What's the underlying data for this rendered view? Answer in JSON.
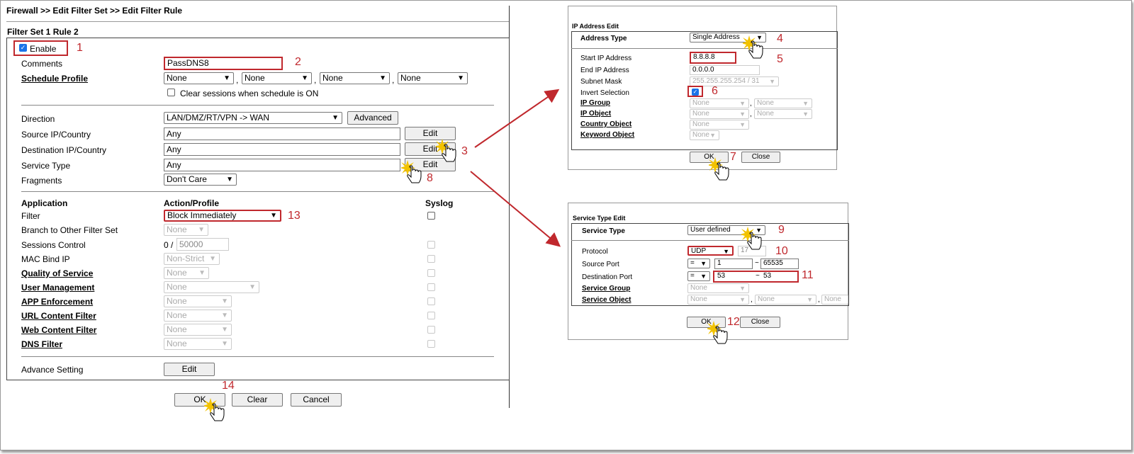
{
  "main": {
    "breadcrumb": "Firewall >> Edit Filter Set >> Edit Filter Rule",
    "section_title": "Filter Set 1 Rule 2",
    "enable_label": "Enable",
    "comments_label": "Comments",
    "comments_value": "PassDNS8",
    "schedule_label": "Schedule Profile",
    "schedule_values": [
      "None",
      "None",
      "None",
      "None"
    ],
    "clear_sessions_label": "Clear sessions when schedule is ON",
    "direction_label": "Direction",
    "direction_value": "LAN/DMZ/RT/VPN -> WAN",
    "advanced_button": "Advanced",
    "source_label": "Source IP/Country",
    "source_value": "Any",
    "destination_label": "Destination IP/Country",
    "destination_value": "Any",
    "service_label": "Service Type",
    "service_value": "Any",
    "edit_button": "Edit",
    "fragments_label": "Fragments",
    "fragments_value": "Don't Care",
    "col_application": "Application",
    "col_action": "Action/Profile",
    "col_syslog": "Syslog",
    "filter_label": "Filter",
    "filter_value": "Block Immediately",
    "branch_label": "Branch to Other Filter Set",
    "branch_value": "None",
    "sessions_label": "Sessions Control",
    "sessions_prefix": "0 /",
    "sessions_value": "50000",
    "mac_label": "MAC Bind IP",
    "mac_value": "Non-Strict",
    "qos_label": "Quality of Service",
    "qos_value": "None",
    "user_label": "User Management",
    "user_value": "None",
    "app_label": "APP Enforcement",
    "app_value": "None",
    "url_label": "URL Content Filter",
    "url_value": "None",
    "web_label": "Web Content Filter",
    "web_value": "None",
    "dns_label": "DNS Filter",
    "dns_value": "None",
    "advance_label": "Advance Setting",
    "ok_button": "OK",
    "clear_button": "Clear",
    "cancel_button": "Cancel"
  },
  "ip_dialog": {
    "title": "IP Address Edit",
    "address_type_label": "Address Type",
    "address_type_value": "Single Address",
    "start_ip_label": "Start IP Address",
    "start_ip_value": "8.8.8.8",
    "end_ip_label": "End IP Address",
    "end_ip_value": "0.0.0.0",
    "mask_label": "Subnet Mask",
    "mask_value": "255.255.255.254 / 31",
    "invert_label": "Invert Selection",
    "ip_group_label": "IP Group",
    "ip_object_label": "IP Object",
    "country_label": "Country Object",
    "keyword_label": "Keyword Object",
    "none": "None",
    "ok_button": "OK",
    "close_button": "Close"
  },
  "svc_dialog": {
    "title": "Service Type Edit",
    "service_type_label": "Service Type",
    "service_type_value": "User defined",
    "protocol_label": "Protocol",
    "protocol_value": "UDP",
    "protocol_number": "17",
    "source_port_label": "Source Port",
    "source_port_op": "=",
    "source_port_from": "1",
    "source_port_tilde": "~",
    "source_port_to": "65535",
    "dest_port_label": "Destination Port",
    "dest_port_op": "=",
    "dest_port_from": "53",
    "dest_port_tilde": "~",
    "dest_port_to": "53",
    "service_group_label": "Service Group",
    "service_object_label": "Service Object",
    "none": "None",
    "ok_button": "OK",
    "close_button": "Close"
  },
  "annotations": [
    "1",
    "2",
    "3",
    "4",
    "5",
    "6",
    "7",
    "8",
    "9",
    "10",
    "11",
    "12",
    "13",
    "14"
  ],
  "colors": {
    "annotation": "#c0282d",
    "checkbox_on": "#1a73e8"
  }
}
